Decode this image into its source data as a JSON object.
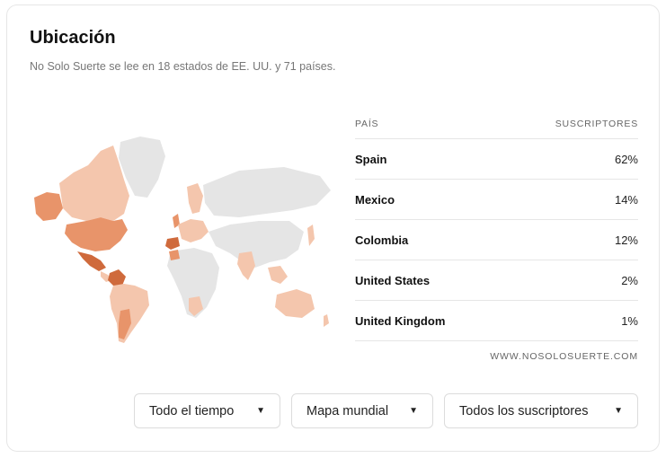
{
  "header": {
    "title": "Ubicación",
    "subtitle": "No Solo Suerte se lee en 18 estados de EE. UU. y 71 países."
  },
  "map": {
    "highlight_color_high": "#cf6a3c",
    "highlight_color_mid": "#e8946a",
    "highlight_color_low": "#f4c6ad",
    "no_data_color": "#e5e5e5"
  },
  "table": {
    "col_country": "PAÍS",
    "col_subscribers": "SUSCRIPTORES",
    "rows": [
      {
        "country": "Spain",
        "pct": "62%"
      },
      {
        "country": "Mexico",
        "pct": "14%"
      },
      {
        "country": "Colombia",
        "pct": "12%"
      },
      {
        "country": "United States",
        "pct": "2%"
      },
      {
        "country": "United Kingdom",
        "pct": "1%"
      }
    ],
    "source": "WWW.NOSOLOSUERTE.COM"
  },
  "filters": {
    "time": "Todo el tiempo",
    "map_type": "Mapa mundial",
    "audience": "Todos los suscriptores"
  }
}
